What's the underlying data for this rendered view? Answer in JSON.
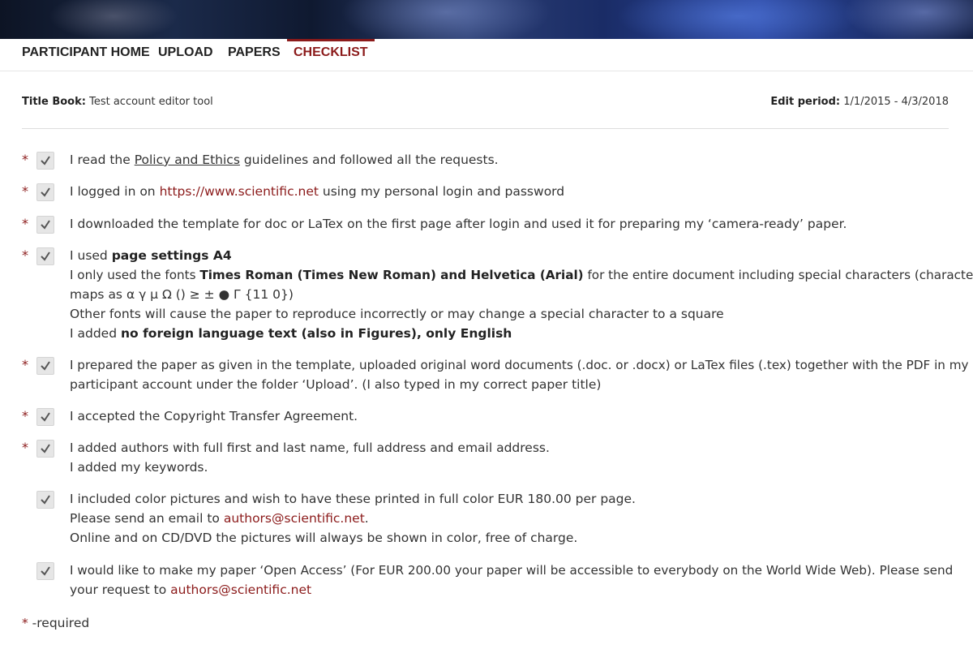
{
  "nav": {
    "items": [
      {
        "label": "PARTICIPANT HOME"
      },
      {
        "label": "UPLOAD"
      },
      {
        "label": "PAPERS"
      },
      {
        "label": "CHECKLIST"
      }
    ],
    "active": "CHECKLIST"
  },
  "info": {
    "title_book_label": "Title Book:",
    "title_book_value": "Test account editor tool",
    "edit_period_label": "Edit period:",
    "edit_period_value": "1/1/2015 - 4/3/2018"
  },
  "checklist": {
    "required_marker": "*",
    "items": [
      {
        "required": true,
        "checked": true,
        "l1_a": "I read the ",
        "l1_link": "Policy and Ethics",
        "l1_b": " guidelines and followed all the requests."
      },
      {
        "required": true,
        "checked": true,
        "l1_a": "I logged in on ",
        "l1_link": "https://www.scientific.net",
        "l1_b": " using my personal login and password"
      },
      {
        "required": true,
        "checked": true,
        "l1": "I downloaded the template for doc or LaTex on the first page after login and used it for preparing my ‘camera-ready’ paper."
      },
      {
        "required": true,
        "checked": true,
        "l1_a": "I used ",
        "l1_bold": "page settings A4",
        "l2_a": "I only used the fonts ",
        "l2_bold": "Times Roman (Times New Roman) and Helvetica (Arial)",
        "l2_b": " for the entire document including special characters (character",
        "l3": "maps as α γ μ Ω () ≥ ± ● Γ {11 0})",
        "l4": "Other fonts will cause the paper to reproduce incorrectly or may change a special character to a square",
        "l5_a": "I added ",
        "l5_bold": "no foreign language text (also in Figures), only English"
      },
      {
        "required": true,
        "checked": true,
        "l1": "I prepared the paper as given in the template, uploaded original word documents (.doc. or .docx) or LaTex files (.tex) together with the PDF in my",
        "l2": "participant account under the folder ‘Upload’. (I also typed in my correct paper title)"
      },
      {
        "required": true,
        "checked": true,
        "l1": "I accepted the Copyright Transfer Agreement."
      },
      {
        "required": true,
        "checked": true,
        "l1": "I added authors with full first and last name, full address and email address.",
        "l2": "I added my keywords."
      },
      {
        "required": false,
        "checked": true,
        "l1": "I included color pictures and wish to have these printed in full color EUR 180.00 per page.",
        "l2_a": "Please send an email to ",
        "l2_link": "authors@scientific.net",
        "l2_b": ".",
        "l3": "Online and on CD/DVD the pictures will always be shown in color, free of charge."
      },
      {
        "required": false,
        "checked": true,
        "l1": "I would like to make my paper ‘Open Access’ (For EUR 200.00 your paper will be accessible to everybody on the World Wide Web). Please send",
        "l2_a": "your request to ",
        "l2_link": "authors@scientific.net"
      }
    ],
    "footnote_star": "*",
    "footnote_text": " -required"
  },
  "colors": {
    "accent": "#8b1a1a",
    "text": "#333333",
    "checkbox_bg": "#e6e6e6"
  },
  "icons": {
    "checkbox": "checkmark-icon"
  }
}
